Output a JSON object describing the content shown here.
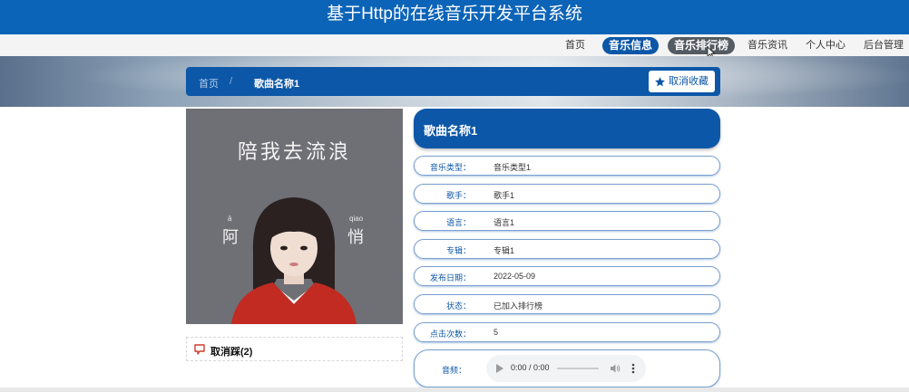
{
  "header": {
    "title": "基于Http的在线音乐开发平台系统"
  },
  "nav": {
    "items": [
      {
        "label": "首页"
      },
      {
        "label": "音乐信息"
      },
      {
        "label": "音乐排行榜"
      },
      {
        "label": "音乐资讯"
      },
      {
        "label": "个人中心"
      },
      {
        "label": "后台管理"
      }
    ]
  },
  "breadcrumb": {
    "home": "首页",
    "separator": "/",
    "current": "歌曲名称1"
  },
  "favorite_button": {
    "label": "取消收藏"
  },
  "cover": {
    "title": "陪我去流浪",
    "artist_left": "阿",
    "artist_left_pinyin": "ā",
    "artist_right": "悄",
    "artist_right_pinyin": "qiao"
  },
  "dislike": {
    "label": "取消踩(2)"
  },
  "detail": {
    "title": "歌曲名称1",
    "fields": [
      {
        "label": "音乐类型：",
        "value": "音乐类型1"
      },
      {
        "label": "歌手：",
        "value": "歌手1"
      },
      {
        "label": "语言：",
        "value": "语言1"
      },
      {
        "label": "专辑：",
        "value": "专辑1"
      },
      {
        "label": "发布日期：",
        "value": "2022-05-09"
      },
      {
        "label": "状态：",
        "value": "已加入排行榜"
      },
      {
        "label": "点击次数：",
        "value": "5"
      }
    ],
    "audio": {
      "label": "音频：",
      "time": "0:00 / 0:00"
    }
  },
  "colors": {
    "primary": "#0c57a8",
    "header": "#0c64b8",
    "nav_active_gray": "#555b63"
  }
}
